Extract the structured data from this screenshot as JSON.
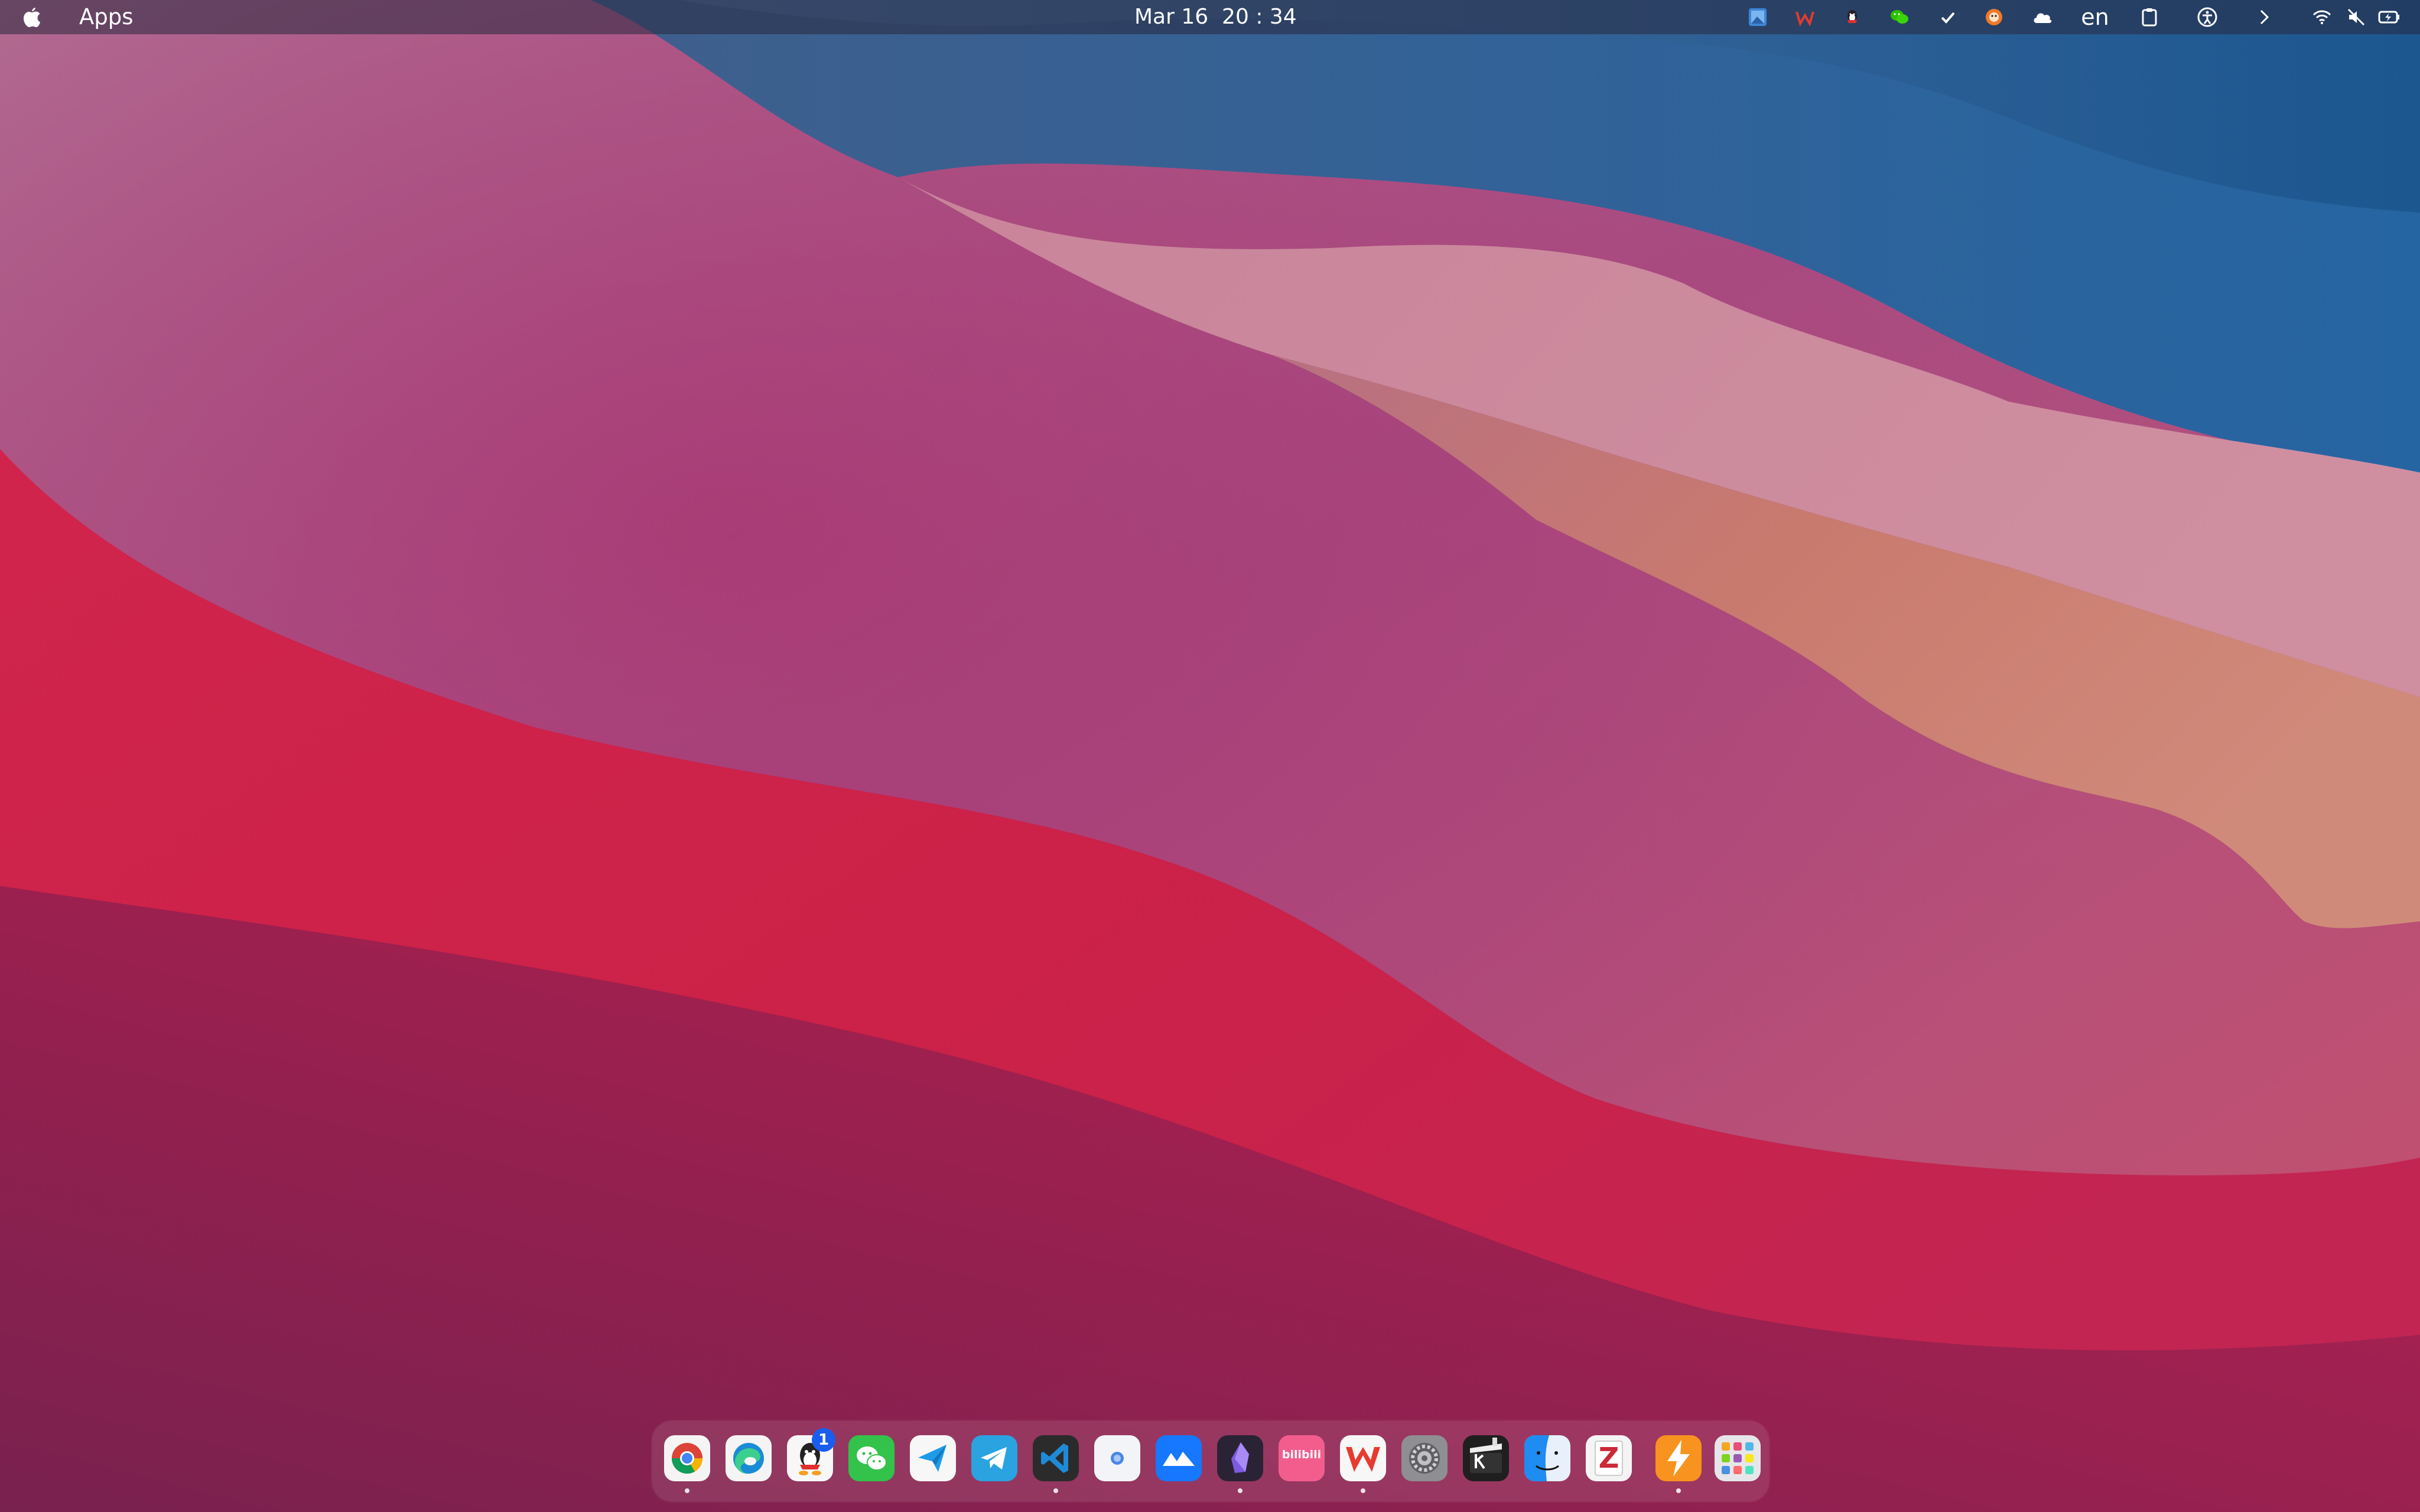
{
  "menubar": {
    "app_name": "Apps",
    "clock": "Mar 16  20 : 34",
    "input_language": "en",
    "tray_icons": [
      "screenshot-tool-icon",
      "wps-icon",
      "qq-icon",
      "wechat-icon",
      "checkmark-icon",
      "weasel-icon",
      "cloud-icon",
      "input-language",
      "clipboard-icon",
      "accessibility-icon",
      "chevron-right-icon",
      "wifi-icon",
      "mute-icon",
      "battery-icon"
    ]
  },
  "dock": {
    "apps": [
      {
        "name": "chrome-icon",
        "running": true
      },
      {
        "name": "edge-icon",
        "running": false
      },
      {
        "name": "qq-icon",
        "running": false,
        "badge": "1"
      },
      {
        "name": "wechat-icon",
        "running": false
      },
      {
        "name": "feishu-send-icon",
        "running": false
      },
      {
        "name": "telegram-icon",
        "running": false
      },
      {
        "name": "vscode-icon",
        "running": true
      },
      {
        "name": "browser-dot-icon",
        "running": false
      },
      {
        "name": "lark-icon",
        "running": false
      },
      {
        "name": "obsidian-icon",
        "running": true
      },
      {
        "name": "bilibili-icon",
        "running": false
      },
      {
        "name": "wps-icon",
        "running": true
      },
      {
        "name": "system-settings-icon",
        "running": false
      },
      {
        "name": "clapper-icon",
        "running": false
      },
      {
        "name": "finder-icon",
        "running": false
      },
      {
        "name": "zotero-icon",
        "running": false
      },
      {
        "name": "flash-icon",
        "running": true
      },
      {
        "name": "launchpad-icon",
        "running": false
      }
    ],
    "bilibili_label": "bilibili",
    "zotero_label": "Z"
  },
  "colors": {
    "wallpaper_blue": "#1d5a9a",
    "wallpaper_pink": "#c8869b",
    "wallpaper_red": "#d02048",
    "wallpaper_magenta": "#8a2055"
  }
}
